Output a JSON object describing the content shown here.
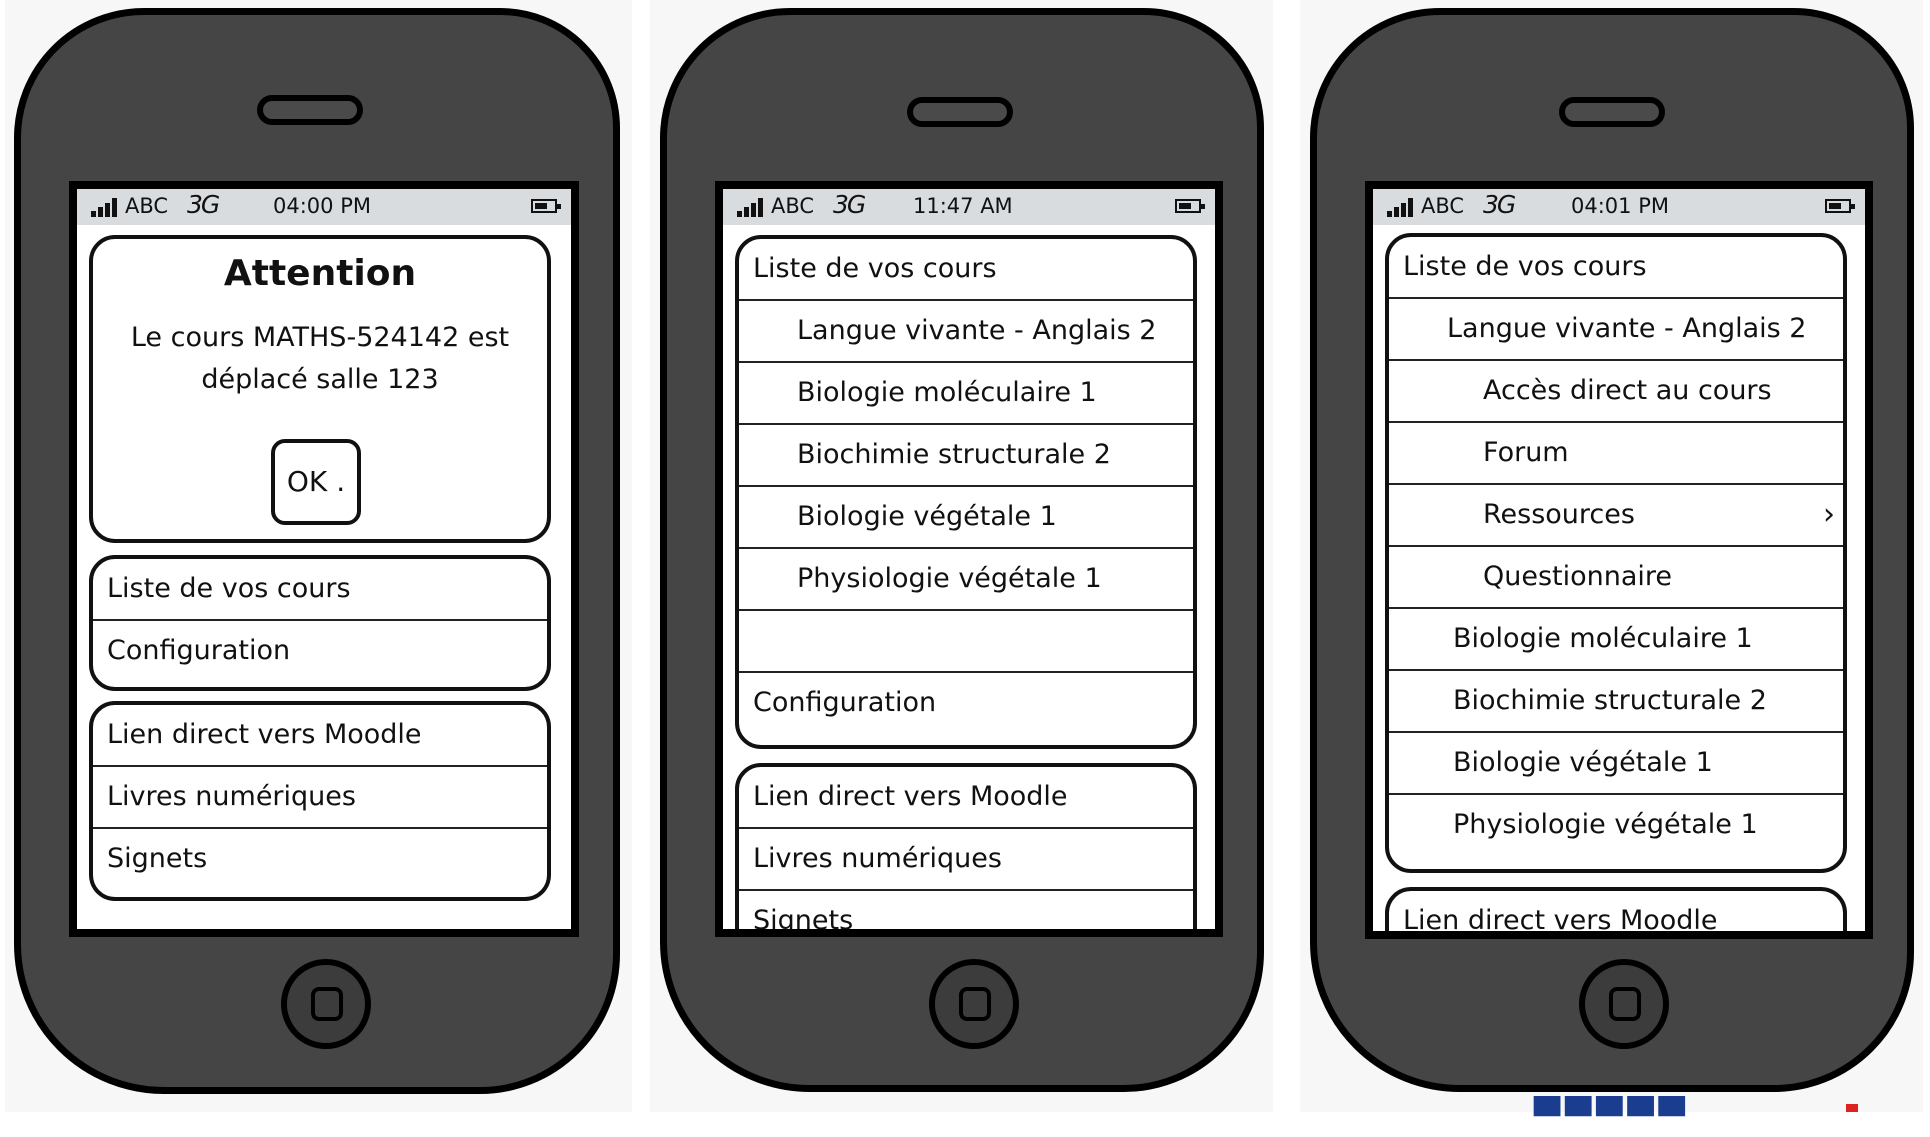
{
  "phone1": {
    "status": {
      "carrier": "ABC",
      "network": "3G",
      "time": "04:00 PM"
    },
    "alert": {
      "title": "Attention",
      "message": "Le cours MATHS-524142 est déplacé salle 123",
      "ok_label": "OK ."
    },
    "menu1": [
      "Liste de vos cours",
      "Configuration"
    ],
    "menu2": [
      "Lien direct vers Moodle",
      "Livres numériques",
      "Signets"
    ]
  },
  "phone2": {
    "status": {
      "carrier": "ABC",
      "network": "3G",
      "time": "11:47 AM"
    },
    "header": "Liste de vos cours",
    "courses": [
      "Langue vivante - Anglais 2",
      "Biologie moléculaire 1",
      "Biochimie structurale 2",
      "Biologie végétale 1",
      "Physiologie végétale 1"
    ],
    "config": "Configuration",
    "menu2": [
      "Lien direct vers Moodle",
      "Livres numériques",
      "Signets"
    ]
  },
  "phone3": {
    "status": {
      "carrier": "ABC",
      "network": "3G",
      "time": "04:01 PM"
    },
    "header": "Liste de vos cours",
    "expanded_course": "Langue vivante - Anglais 2",
    "sub_items": [
      "Accès direct au cours",
      "Forum",
      "Ressources",
      "Questionnaire"
    ],
    "courses": [
      "Biologie moléculaire 1",
      "Biochimie structurale 2",
      "Biologie végétale 1",
      "Physiologie végétale 1"
    ],
    "menu2": [
      "Lien direct vers Moodle"
    ]
  },
  "icons": [
    "signal-icon",
    "battery-icon",
    "chevron-right-icon",
    "home-button-icon",
    "speaker-icon"
  ],
  "colors": {
    "phone_body": "#454545",
    "statusbar": "#d9dcdf",
    "outline": "#000000"
  }
}
